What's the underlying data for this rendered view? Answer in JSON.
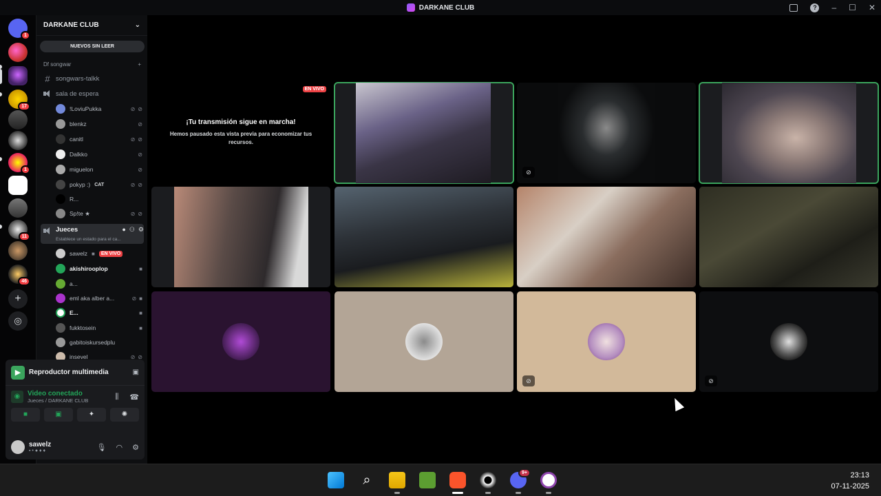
{
  "window": {
    "title": "DARKANE CLUB"
  },
  "rail": {
    "servers": [
      {
        "badge": "1"
      },
      {
        "badge": ""
      },
      {
        "badge": ""
      },
      {
        "badge": "17"
      },
      {
        "badge": ""
      },
      {
        "badge": ""
      },
      {
        "badge": "1"
      },
      {
        "badge": ""
      },
      {
        "badge": ""
      },
      {
        "badge": "11"
      },
      {
        "badge": ""
      },
      {
        "badge": "46"
      }
    ]
  },
  "sidebar": {
    "server_name": "DARKANE CLUB",
    "unread_pill": "NUEVOS SIN LEER",
    "category": "Df songwar",
    "channels": {
      "text": "songwars-talkk",
      "waiting": "sala de espera",
      "judges": "Jueces",
      "judges_status": "Establece un estado para el ca..."
    },
    "waiting_users": [
      "!LoviuPukka",
      "blenkz",
      "canitl",
      "Dalkko",
      "miguelon",
      "pokyp :)",
      "R...",
      "Sp!te ★"
    ],
    "pokyp_tag": "CAT",
    "judges_users": [
      "sawelz",
      "akishirooplop",
      "a...",
      "eml aka alber a...",
      "E...",
      "fukktosein",
      "gabitoiskursedplu",
      "insevel"
    ],
    "live_label": "EN VIVO"
  },
  "media": {
    "title": "Reproductor multimedia",
    "voice_status": "Video conectado",
    "voice_channel": "Jueces / DARKANE CLUB"
  },
  "user_panel": {
    "name": "sawelz"
  },
  "stage": {
    "live_badge": "EN VIVO",
    "preview_heading": "¡Tu transmisión sigue en marcha!",
    "preview_text": "Hemos pausado esta vista previa para economizar tus recursos."
  },
  "taskbar": {
    "time": "23:13",
    "date": "07-11-2025",
    "discord_badge": "9+"
  }
}
